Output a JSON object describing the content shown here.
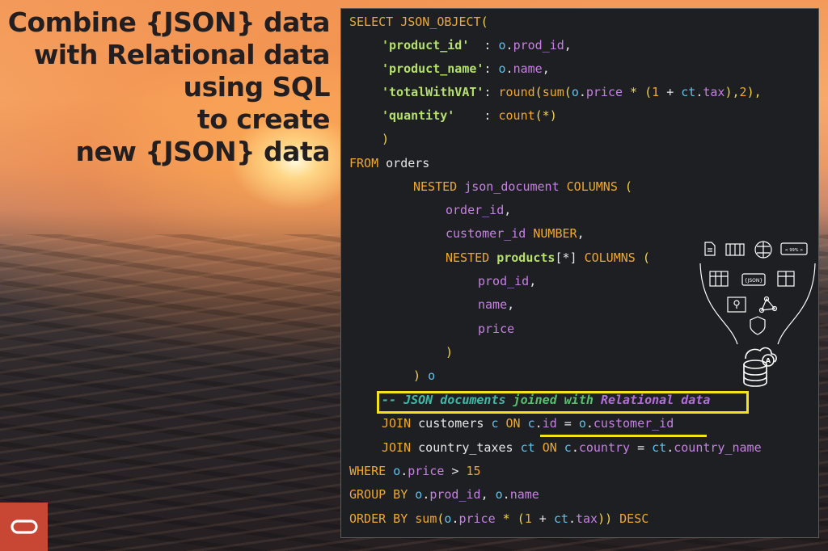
{
  "headline": {
    "line1": "Combine {JSON} data",
    "line2": "with Relational data",
    "line3": "using SQL",
    "line4": "to create",
    "line5": "new {JSON} data"
  },
  "code": {
    "l1": [
      "SELECT",
      " ",
      "JSON_OBJECT",
      "("
    ],
    "l2": [
      "'product_id'",
      "  : ",
      "o",
      ".",
      "prod_id",
      ","
    ],
    "l3": [
      "'product_name'",
      ": ",
      "o",
      ".",
      "name",
      ","
    ],
    "l4": [
      "'totalWithVAT'",
      ": ",
      "round",
      "(",
      "sum",
      "(",
      "o",
      ".",
      "price",
      " * (",
      "1",
      " + ",
      "ct",
      ".",
      "tax",
      "),",
      "2",
      "),"
    ],
    "l5": [
      "'quantity'",
      "    : ",
      "count",
      "(*)"
    ],
    "l6": [
      ")"
    ],
    "l7": [
      "FROM",
      " orders"
    ],
    "l8": [
      "NESTED",
      " ",
      "json_document",
      " ",
      "COLUMNS",
      " ("
    ],
    "l9": [
      "order_id",
      ","
    ],
    "l10": [
      "customer_id",
      " ",
      "NUMBER",
      ","
    ],
    "l11": [
      "NESTED",
      " ",
      "products",
      "[*]",
      " ",
      "COLUMNS",
      " ("
    ],
    "l12": [
      "prod_id",
      ","
    ],
    "l13": [
      "name",
      ","
    ],
    "l14": [
      "price"
    ],
    "l15": [
      ")"
    ],
    "l16": [
      ")",
      " ",
      "o"
    ],
    "l17": [
      "-- ",
      "JSON documents",
      " joined with ",
      "Relational data"
    ],
    "l18": [
      "JOIN",
      " customers ",
      "c",
      " ",
      "ON",
      " ",
      "c",
      ".",
      "id",
      " = ",
      "o",
      ".",
      "customer_id"
    ],
    "l19": [
      "JOIN",
      " country_taxes ",
      "ct",
      " ",
      "ON",
      " ",
      "c",
      ".",
      "country",
      " = ",
      "ct",
      ".",
      "country_name"
    ],
    "l20": [
      "WHERE",
      " ",
      "o",
      ".",
      "price",
      " > ",
      "15"
    ],
    "l21": [
      "GROUP BY",
      " ",
      "o",
      ".",
      "prod_id",
      ", ",
      "o",
      ".",
      "name"
    ],
    "l22": [
      "ORDER BY",
      " ",
      "sum",
      "(",
      "o",
      ".",
      "price",
      " * (",
      "1",
      " + ",
      "ct",
      ".",
      "tax",
      ")) ",
      "DESC"
    ]
  },
  "icons": {
    "json_badge": "{JSON}",
    "percent_badge": "< 99% >",
    "names": [
      "document-icon",
      "columnar-icon",
      "brain-icon",
      "percent-icon",
      "table-icon",
      "json-icon",
      "split-table-icon",
      "map-icon",
      "graph-icon",
      "shield-icon",
      "database-icon"
    ]
  },
  "logo": {
    "name": "oracle-logo-icon",
    "color": "#c74634"
  }
}
